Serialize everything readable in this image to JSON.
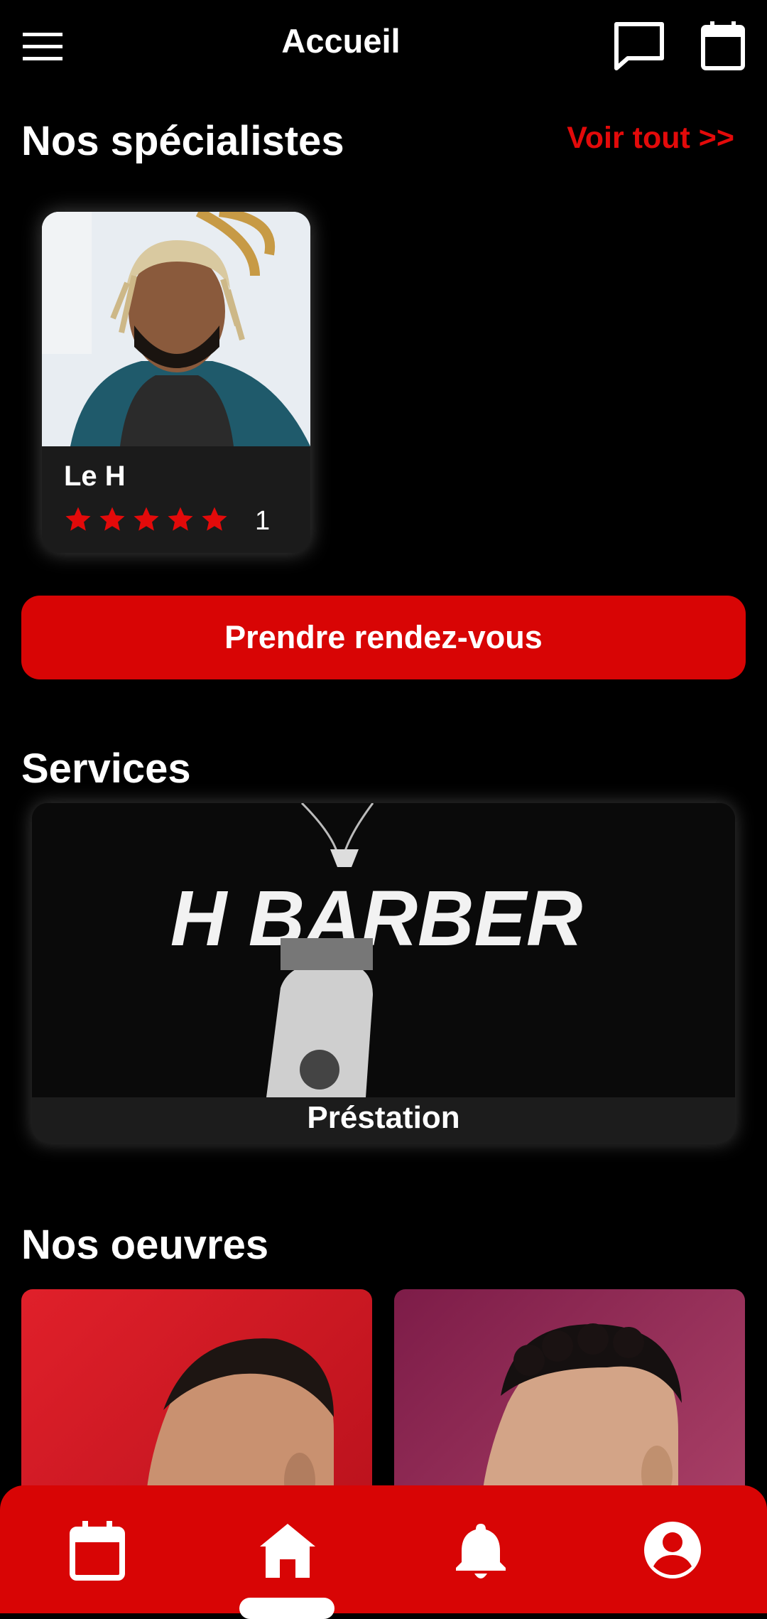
{
  "header": {
    "title": "Accueil"
  },
  "specialists": {
    "heading": "Nos spécialistes",
    "see_all": "Voir tout >>",
    "items": [
      {
        "name": "Le H",
        "rating": 5,
        "rating_count": "1"
      }
    ]
  },
  "booking": {
    "button_label": "Prendre rendez-vous"
  },
  "services": {
    "heading": "Services",
    "items": [
      {
        "label": "Préstation",
        "image_text": "H BARBER"
      }
    ]
  },
  "works": {
    "heading": "Nos oeuvres"
  },
  "colors": {
    "accent": "#d80505",
    "background": "#000000",
    "card": "#1b1b1b"
  },
  "bottom_nav": {
    "items": [
      {
        "icon": "calendar-icon"
      },
      {
        "icon": "home-icon",
        "active": true
      },
      {
        "icon": "bell-icon"
      },
      {
        "icon": "account-icon"
      }
    ]
  }
}
